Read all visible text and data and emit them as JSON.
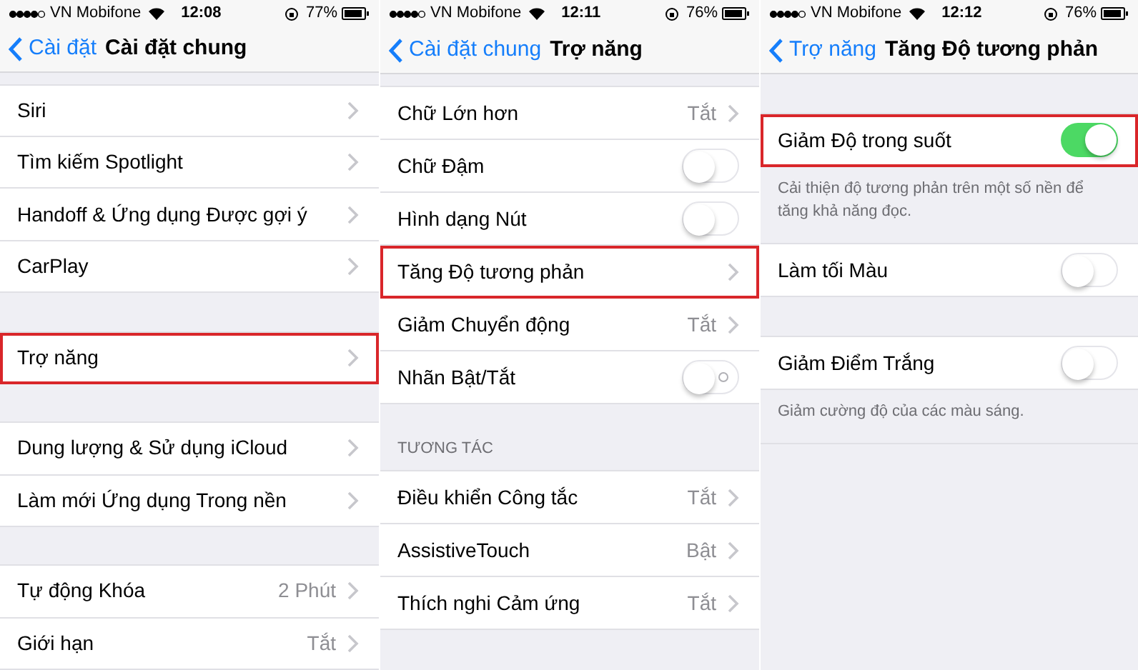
{
  "panels": [
    {
      "status_bar": {
        "carrier": "VN Mobifone",
        "time": "12:08",
        "battery": "77%"
      },
      "nav": {
        "back": "Cài đặt",
        "title": "Cài đặt chung"
      },
      "items": [
        {
          "kind": "top_gap"
        },
        {
          "kind": "row",
          "label": "Siri",
          "highlighted": false
        },
        {
          "kind": "row",
          "label": "Tìm kiếm Spotlight",
          "highlighted": false
        },
        {
          "kind": "row",
          "label": "Handoff & Ứng dụng Được gợi ý",
          "highlighted": false
        },
        {
          "kind": "row",
          "label": "CarPlay",
          "highlighted": false
        },
        {
          "kind": "gap"
        },
        {
          "kind": "row",
          "label": "Trợ năng",
          "highlighted": true
        },
        {
          "kind": "gap"
        },
        {
          "kind": "row",
          "label": "Dung lượng & Sử dụng iCloud",
          "highlighted": false
        },
        {
          "kind": "row",
          "label": "Làm mới Ứng dụng Trong nền",
          "highlighted": false
        },
        {
          "kind": "gap"
        },
        {
          "kind": "row",
          "label": "Tự động Khóa",
          "value": "2 Phút",
          "highlighted": false
        },
        {
          "kind": "row",
          "label": "Giới hạn",
          "value": "Tắt",
          "highlighted": false
        }
      ]
    },
    {
      "status_bar": {
        "carrier": "VN Mobifone",
        "time": "12:11",
        "battery": "76%"
      },
      "nav": {
        "back": "Cài đặt chung",
        "title": "Trợ năng"
      },
      "items": [
        {
          "kind": "top_gap"
        },
        {
          "kind": "row",
          "label": "Chữ Lớn hơn",
          "value": "Tắt",
          "highlighted": false
        },
        {
          "kind": "toggle",
          "label": "Chữ Đậm",
          "on": false,
          "highlighted": false
        },
        {
          "kind": "toggle",
          "label": "Hình dạng Nút",
          "on": false,
          "highlighted": false
        },
        {
          "kind": "row",
          "label": "Tăng Độ tương phản",
          "highlighted": true
        },
        {
          "kind": "row",
          "label": "Giảm Chuyển động",
          "value": "Tắt",
          "highlighted": false
        },
        {
          "kind": "toggle",
          "label": "Nhãn Bật/Tắt",
          "on": false,
          "highlighted": false,
          "on_off_labels": true
        },
        {
          "kind": "header",
          "text": "TƯƠNG TÁC"
        },
        {
          "kind": "row",
          "label": "Điều khiển Công tắc",
          "value": "Tắt",
          "highlighted": false
        },
        {
          "kind": "row",
          "label": "AssistiveTouch",
          "value": "Bật",
          "highlighted": false
        },
        {
          "kind": "row",
          "label": "Thích nghi Cảm ứng",
          "value": "Tắt",
          "highlighted": false
        }
      ]
    },
    {
      "status_bar": {
        "carrier": "VN Mobifone",
        "time": "12:12",
        "battery": "76%"
      },
      "nav": {
        "back": "Trợ năng",
        "title": "Tăng Độ tương phản"
      },
      "items": [
        {
          "kind": "gap"
        },
        {
          "kind": "toggle",
          "label": "Giảm Độ trong suốt",
          "on": true,
          "highlighted": true
        },
        {
          "kind": "note",
          "text": "Cải thiện độ tương phản trên một số nền để tăng khả năng đọc."
        },
        {
          "kind": "toggle",
          "label": "Làm tối Màu",
          "on": false,
          "highlighted": false
        },
        {
          "kind": "gap"
        },
        {
          "kind": "toggle",
          "label": "Giảm Điểm Trắng",
          "on": false,
          "highlighted": false
        },
        {
          "kind": "note",
          "text": "Giảm cường độ của các màu sáng."
        }
      ]
    }
  ]
}
